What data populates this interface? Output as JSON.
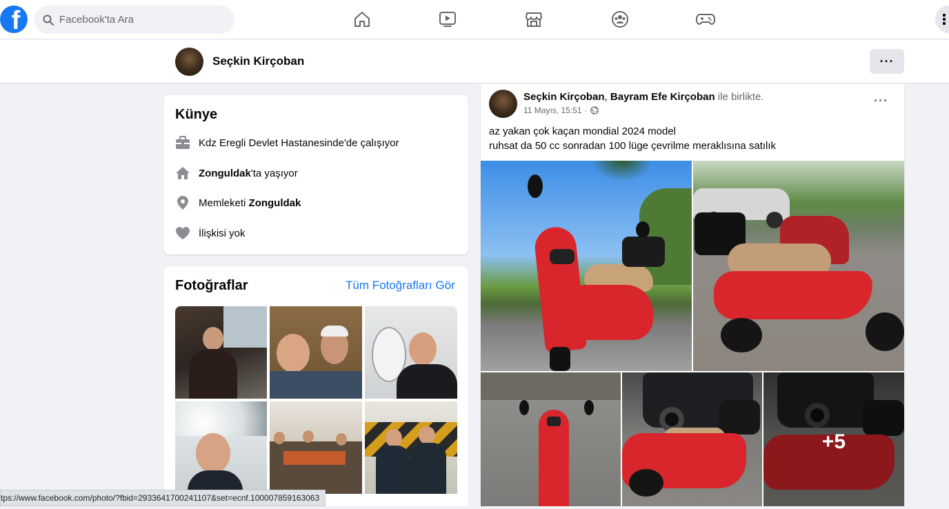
{
  "header": {
    "search_placeholder": "Facebook'ta Ara",
    "nav": [
      {
        "name": "home"
      },
      {
        "name": "watch"
      },
      {
        "name": "marketplace"
      },
      {
        "name": "groups"
      },
      {
        "name": "gaming"
      }
    ]
  },
  "profile": {
    "name": "Seçkin Kirçoban",
    "more_label": "···"
  },
  "intro": {
    "title": "Künye",
    "work": "Kdz Eregli Devlet Hastanesinde'de çalışıyor",
    "lives_city": "Zonguldak",
    "lives_suffix": "'ta yaşıyor",
    "from_prefix": "Memleketi ",
    "from_city": "Zonguldak",
    "relationship": "İlişkisi yok"
  },
  "photos": {
    "title": "Fotoğraflar",
    "see_all": "Tüm Fotoğrafları Gör"
  },
  "post": {
    "author": "Seçkin Kirçoban",
    "separator": ", ",
    "tagged": "Bayram Efe Kirçoban",
    "with_text": " ile birlikte.",
    "date": "11 Mayıs, 15:51",
    "dot": "·",
    "line1": "az yakan çok kaçan mondial 2024 model",
    "line2": "ruhsat da 50 cc sonradan 100 lüge çevrilme meraklısına satılık",
    "more_photos": "+5",
    "options": "···"
  },
  "status_url": "tps://www.facebook.com/photo/?fbid=2933641700241107&set=ecnf.100007859163063",
  "colors": {
    "brand": "#1877f2",
    "background": "#f0f2f5",
    "scooter_red": "#d9262c"
  }
}
